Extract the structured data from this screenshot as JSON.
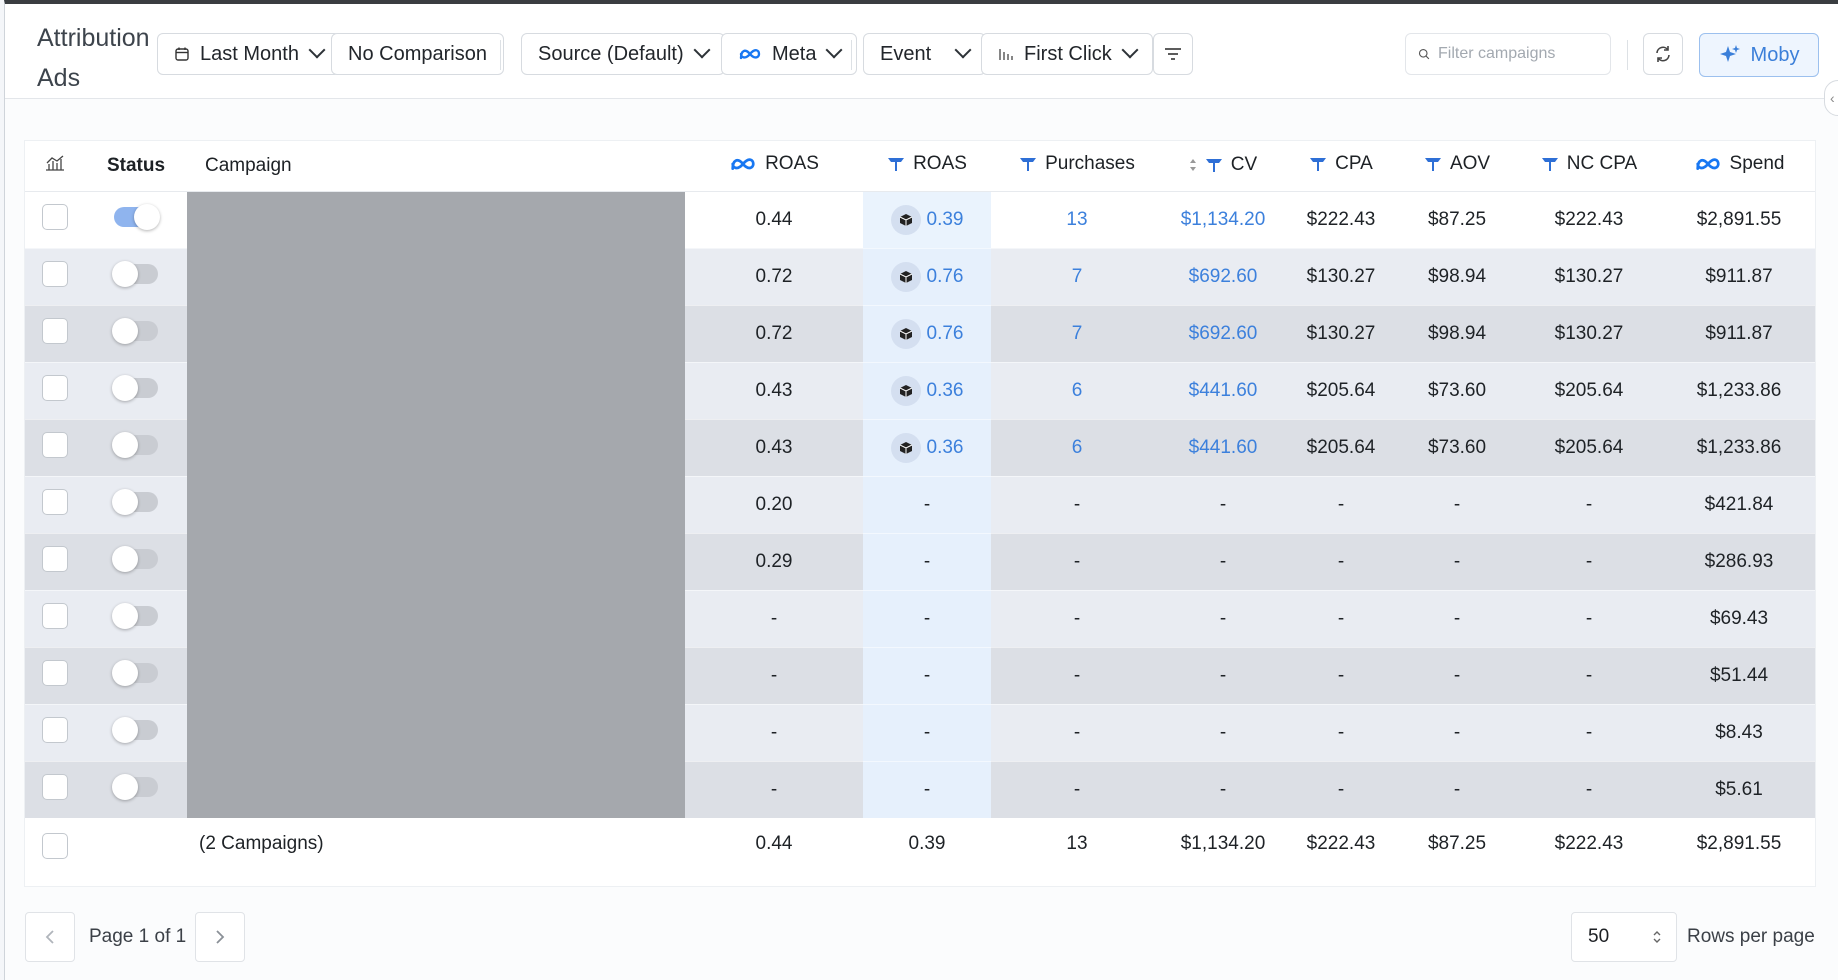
{
  "header": {
    "title": "Attribution - Ads",
    "date_range": "Last Month",
    "comparison": "No Comparison",
    "source": "Source (Default)",
    "platform": "Meta",
    "event": "Event",
    "attribution_model": "First Click",
    "search_placeholder": "Filter campaigns",
    "moby_label": "Moby"
  },
  "table": {
    "columns": {
      "status": "Status",
      "campaign": "Campaign",
      "meta_roas": "ROAS",
      "roas": "ROAS",
      "purchases": "Purchases",
      "cv": "CV",
      "cpa": "CPA",
      "aov": "AOV",
      "nc_cpa": "NC CPA",
      "spend": "Spend"
    },
    "rows": [
      {
        "active": true,
        "meta_roas": "0.44",
        "roas": "0.39",
        "purchases": "13",
        "cv": "$1,134.20",
        "cpa": "$222.43",
        "aov": "$87.25",
        "nc_cpa": "$222.43",
        "spend": "$2,891.55"
      },
      {
        "active": false,
        "meta_roas": "0.72",
        "roas": "0.76",
        "purchases": "7",
        "cv": "$692.60",
        "cpa": "$130.27",
        "aov": "$98.94",
        "nc_cpa": "$130.27",
        "spend": "$911.87"
      },
      {
        "active": false,
        "meta_roas": "0.72",
        "roas": "0.76",
        "purchases": "7",
        "cv": "$692.60",
        "cpa": "$130.27",
        "aov": "$98.94",
        "nc_cpa": "$130.27",
        "spend": "$911.87"
      },
      {
        "active": false,
        "meta_roas": "0.43",
        "roas": "0.36",
        "purchases": "6",
        "cv": "$441.60",
        "cpa": "$205.64",
        "aov": "$73.60",
        "nc_cpa": "$205.64",
        "spend": "$1,233.86"
      },
      {
        "active": false,
        "meta_roas": "0.43",
        "roas": "0.36",
        "purchases": "6",
        "cv": "$441.60",
        "cpa": "$205.64",
        "aov": "$73.60",
        "nc_cpa": "$205.64",
        "spend": "$1,233.86"
      },
      {
        "active": false,
        "meta_roas": "0.20",
        "roas": "-",
        "purchases": "-",
        "cv": "-",
        "cpa": "-",
        "aov": "-",
        "nc_cpa": "-",
        "spend": "$421.84"
      },
      {
        "active": false,
        "meta_roas": "0.29",
        "roas": "-",
        "purchases": "-",
        "cv": "-",
        "cpa": "-",
        "aov": "-",
        "nc_cpa": "-",
        "spend": "$286.93"
      },
      {
        "active": false,
        "meta_roas": "-",
        "roas": "-",
        "purchases": "-",
        "cv": "-",
        "cpa": "-",
        "aov": "-",
        "nc_cpa": "-",
        "spend": "$69.43"
      },
      {
        "active": false,
        "meta_roas": "-",
        "roas": "-",
        "purchases": "-",
        "cv": "-",
        "cpa": "-",
        "aov": "-",
        "nc_cpa": "-",
        "spend": "$51.44"
      },
      {
        "active": false,
        "meta_roas": "-",
        "roas": "-",
        "purchases": "-",
        "cv": "-",
        "cpa": "-",
        "aov": "-",
        "nc_cpa": "-",
        "spend": "$8.43"
      },
      {
        "active": false,
        "meta_roas": "-",
        "roas": "-",
        "purchases": "-",
        "cv": "-",
        "cpa": "-",
        "aov": "-",
        "nc_cpa": "-",
        "spend": "$5.61"
      }
    ],
    "total": {
      "campaign": "(2 Campaigns)",
      "meta_roas": "0.44",
      "roas": "0.39",
      "purchases": "13",
      "cv": "$1,134.20",
      "cpa": "$222.43",
      "aov": "$87.25",
      "nc_cpa": "$222.43",
      "spend": "$2,891.55"
    }
  },
  "footer": {
    "page_info": "Page 1 of 1",
    "rows_per_page_value": "50",
    "rows_per_page_label": "Rows per page"
  },
  "colors": {
    "accent": "#3c80dc",
    "meta_blue": "#1877f2",
    "triple_whale_blue": "#2e6fd6"
  }
}
